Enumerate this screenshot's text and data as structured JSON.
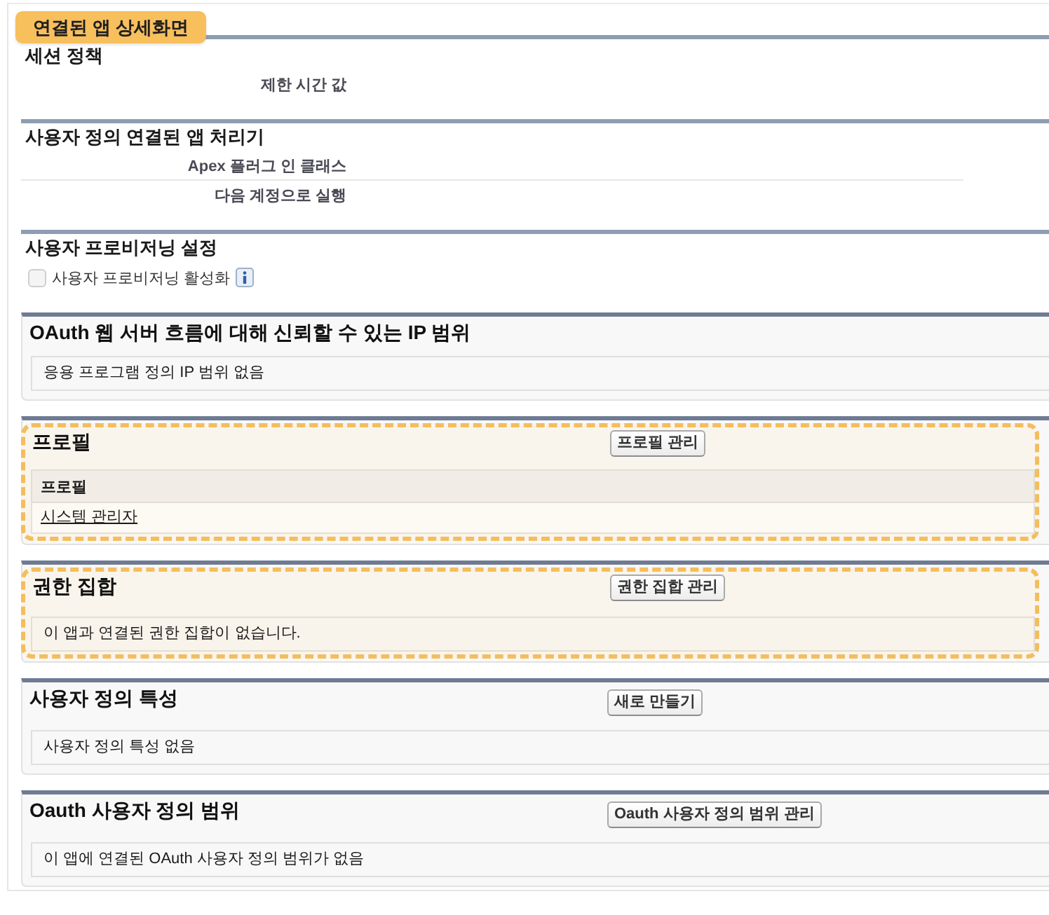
{
  "annotation_label": {
    "text": "연결된 앱 상세화면"
  },
  "detail_sections": [
    {
      "kind": "fields",
      "title": "세션 정책",
      "fields": [
        {
          "label": "제한 시간 값"
        }
      ]
    },
    {
      "kind": "fields",
      "title": "사용자 정의 연결된 앱 처리기",
      "fields": [
        {
          "label": "Apex 플러그 인 클래스"
        },
        {
          "label": "다음 계정으로 실행"
        }
      ]
    },
    {
      "kind": "checkbox",
      "title": "사용자 프로비저닝 설정",
      "checkbox": {
        "label": "사용자 프로비저닝 활성화",
        "checked": false,
        "disabled": true
      }
    }
  ],
  "related_lists": [
    {
      "kind": "message",
      "title": "OAuth 웹 서버 흐름에 대해 신뢰할 수 있는 IP 범위",
      "highlighted": false,
      "message": "응용 프로그램 정의 IP 범위 없음"
    },
    {
      "kind": "table",
      "title": "프로필",
      "button": "프로필 관리",
      "highlighted": true,
      "table": {
        "columns": [
          "프로필"
        ],
        "rows": [
          [
            "시스템 관리자"
          ]
        ]
      }
    },
    {
      "kind": "message",
      "title": "권한 집합",
      "button": "권한 집합 관리",
      "highlighted": true,
      "message": "이 앱과 연결된 권한 집합이 없습니다."
    },
    {
      "kind": "message",
      "title": "사용자 정의 특성",
      "button": "새로 만들기",
      "highlighted": false,
      "message": "사용자 정의 특성 없음"
    },
    {
      "kind": "message",
      "title": "Oauth 사용자 정의 범위",
      "button": "Oauth 사용자 정의 범위 관리",
      "highlighted": false,
      "message": "이 앱에 연결된 OAuth 사용자 정의 범위가 없음"
    }
  ]
}
